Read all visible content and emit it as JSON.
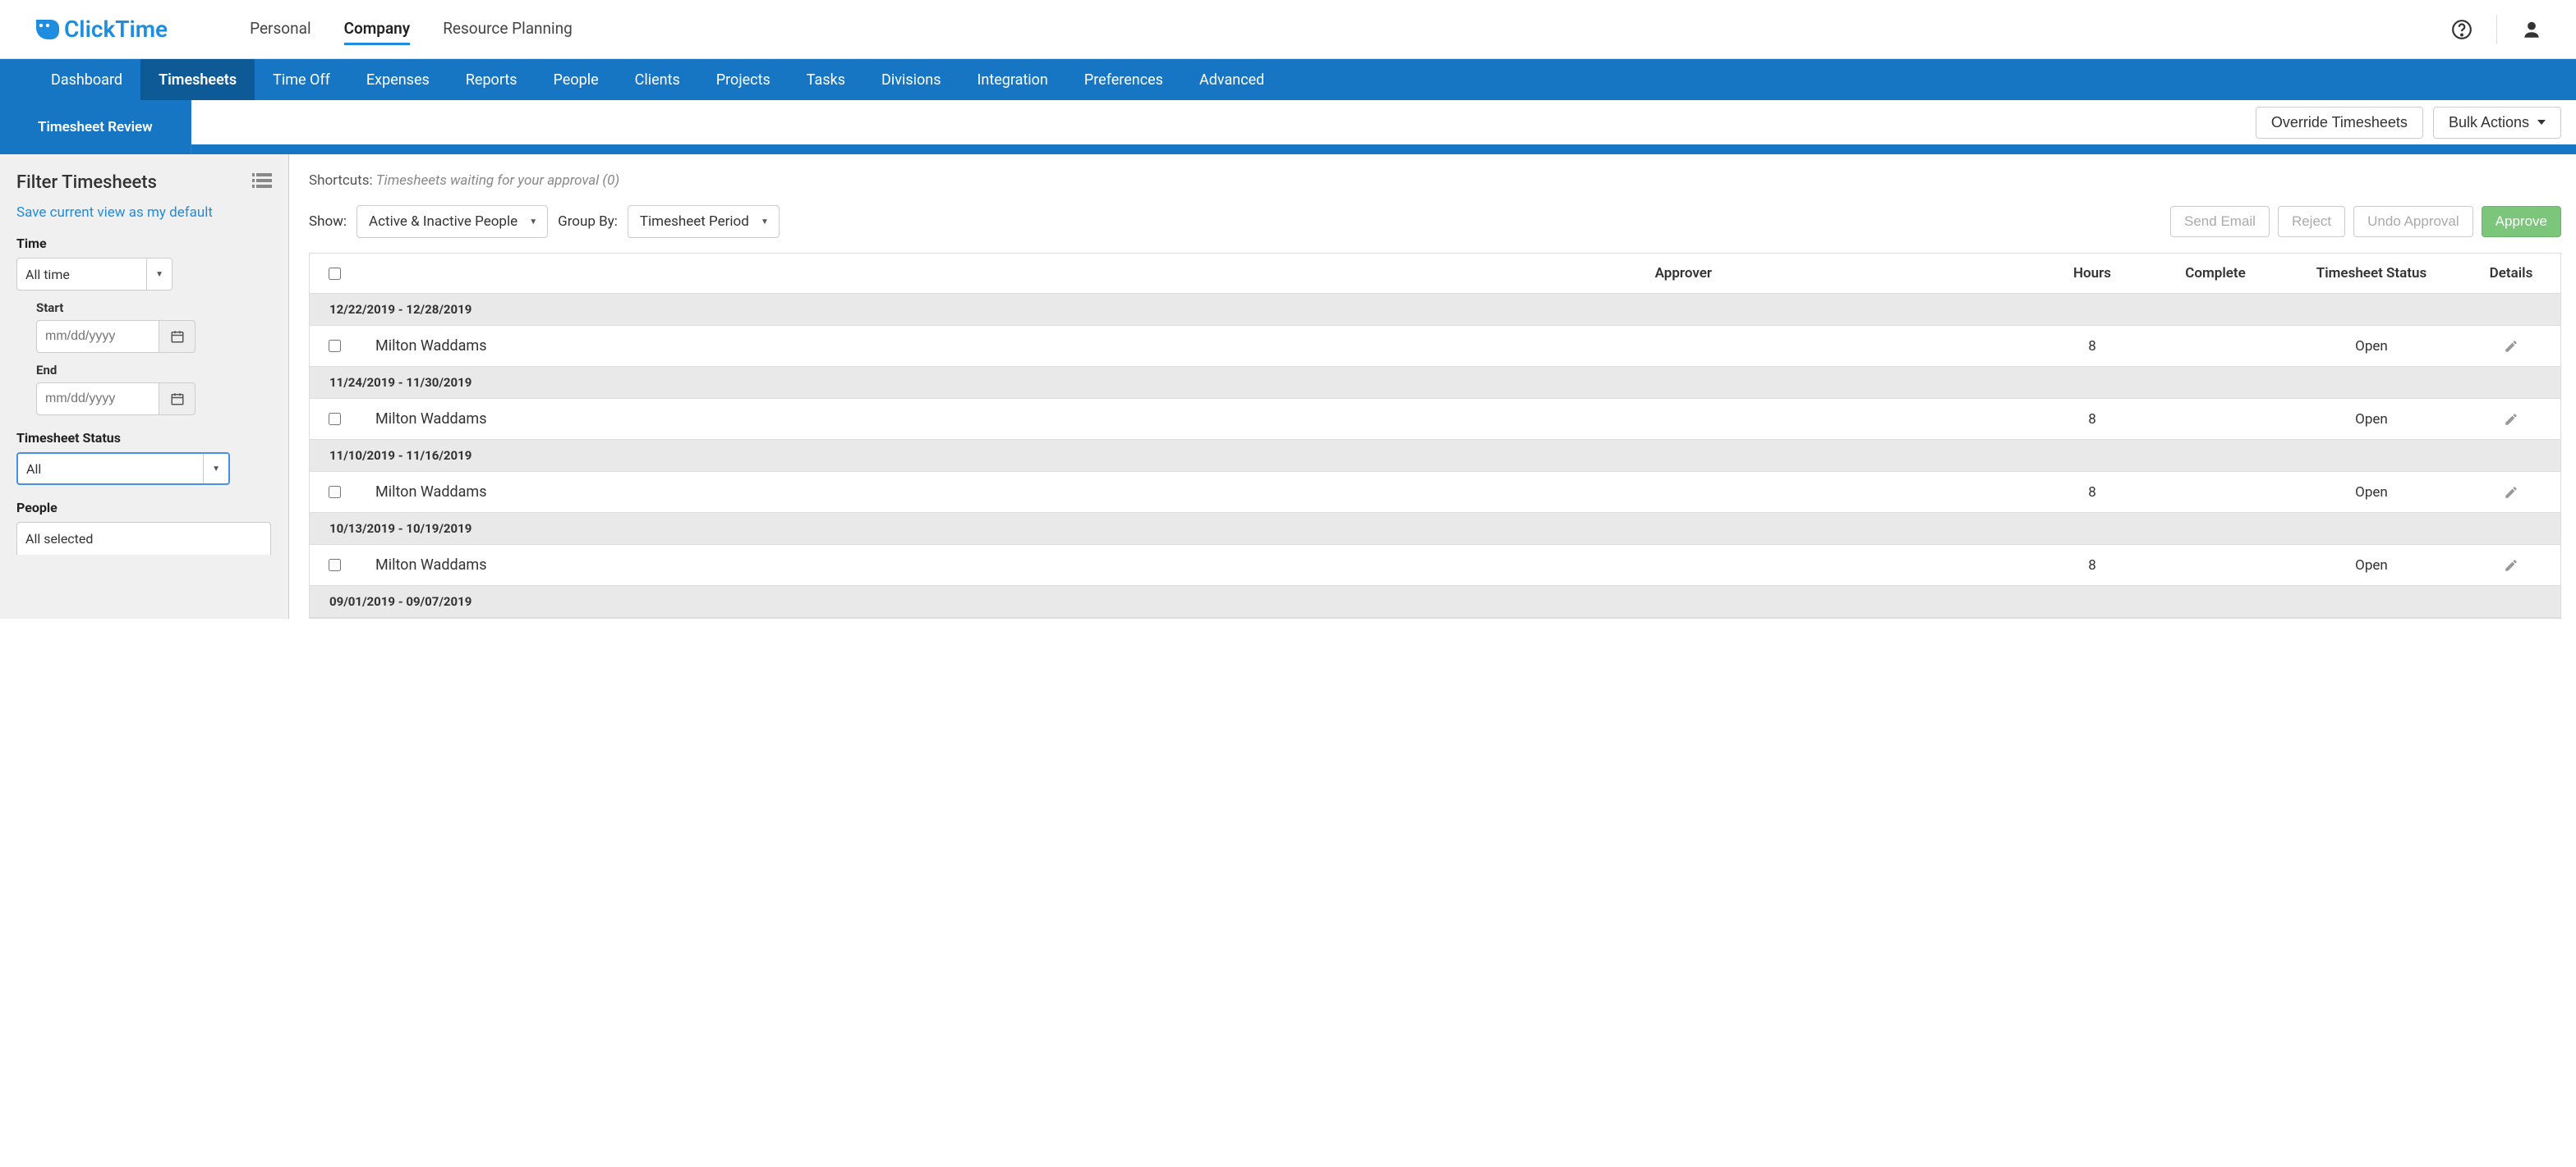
{
  "logo": "ClickTime",
  "topnav": {
    "items": [
      "Personal",
      "Company",
      "Resource Planning"
    ],
    "active_index": 1
  },
  "nav2": {
    "items": [
      "Dashboard",
      "Timesheets",
      "Time Off",
      "Expenses",
      "Reports",
      "People",
      "Clients",
      "Projects",
      "Tasks",
      "Divisions",
      "Integration",
      "Preferences",
      "Advanced"
    ],
    "active_index": 1
  },
  "subtab": "Timesheet Review",
  "header_buttons": {
    "override": "Override Timesheets",
    "bulk": "Bulk Actions"
  },
  "sidebar": {
    "title": "Filter Timesheets",
    "save_link": "Save current view as my default",
    "time_label": "Time",
    "time_select": "All time",
    "start_label": "Start",
    "end_label": "End",
    "date_placeholder": "mm/dd/yyyy",
    "status_label": "Timesheet Status",
    "status_select": "All",
    "people_label": "People",
    "people_select": "All selected"
  },
  "shortcuts": {
    "label": "Shortcuts:",
    "text": "Timesheets waiting for your approval (0)"
  },
  "controls": {
    "show_label": "Show:",
    "show_value": "Active & Inactive People",
    "group_label": "Group By:",
    "group_value": "Timesheet Period",
    "send_email": "Send Email",
    "reject": "Reject",
    "undo": "Undo Approval",
    "approve": "Approve"
  },
  "table": {
    "headers": {
      "approver": "Approver",
      "hours": "Hours",
      "complete": "Complete",
      "status": "Timesheet Status",
      "details": "Details"
    },
    "groups": [
      {
        "period": "12/22/2019 - 12/28/2019",
        "rows": [
          {
            "name": "Milton Waddams",
            "hours": "8",
            "status": "Open"
          }
        ]
      },
      {
        "period": "11/24/2019 - 11/30/2019",
        "rows": [
          {
            "name": "Milton Waddams",
            "hours": "8",
            "status": "Open"
          }
        ]
      },
      {
        "period": "11/10/2019 - 11/16/2019",
        "rows": [
          {
            "name": "Milton Waddams",
            "hours": "8",
            "status": "Open"
          }
        ]
      },
      {
        "period": "10/13/2019 - 10/19/2019",
        "rows": [
          {
            "name": "Milton Waddams",
            "hours": "8",
            "status": "Open"
          }
        ]
      },
      {
        "period": "09/01/2019 - 09/07/2019",
        "rows": []
      }
    ]
  }
}
